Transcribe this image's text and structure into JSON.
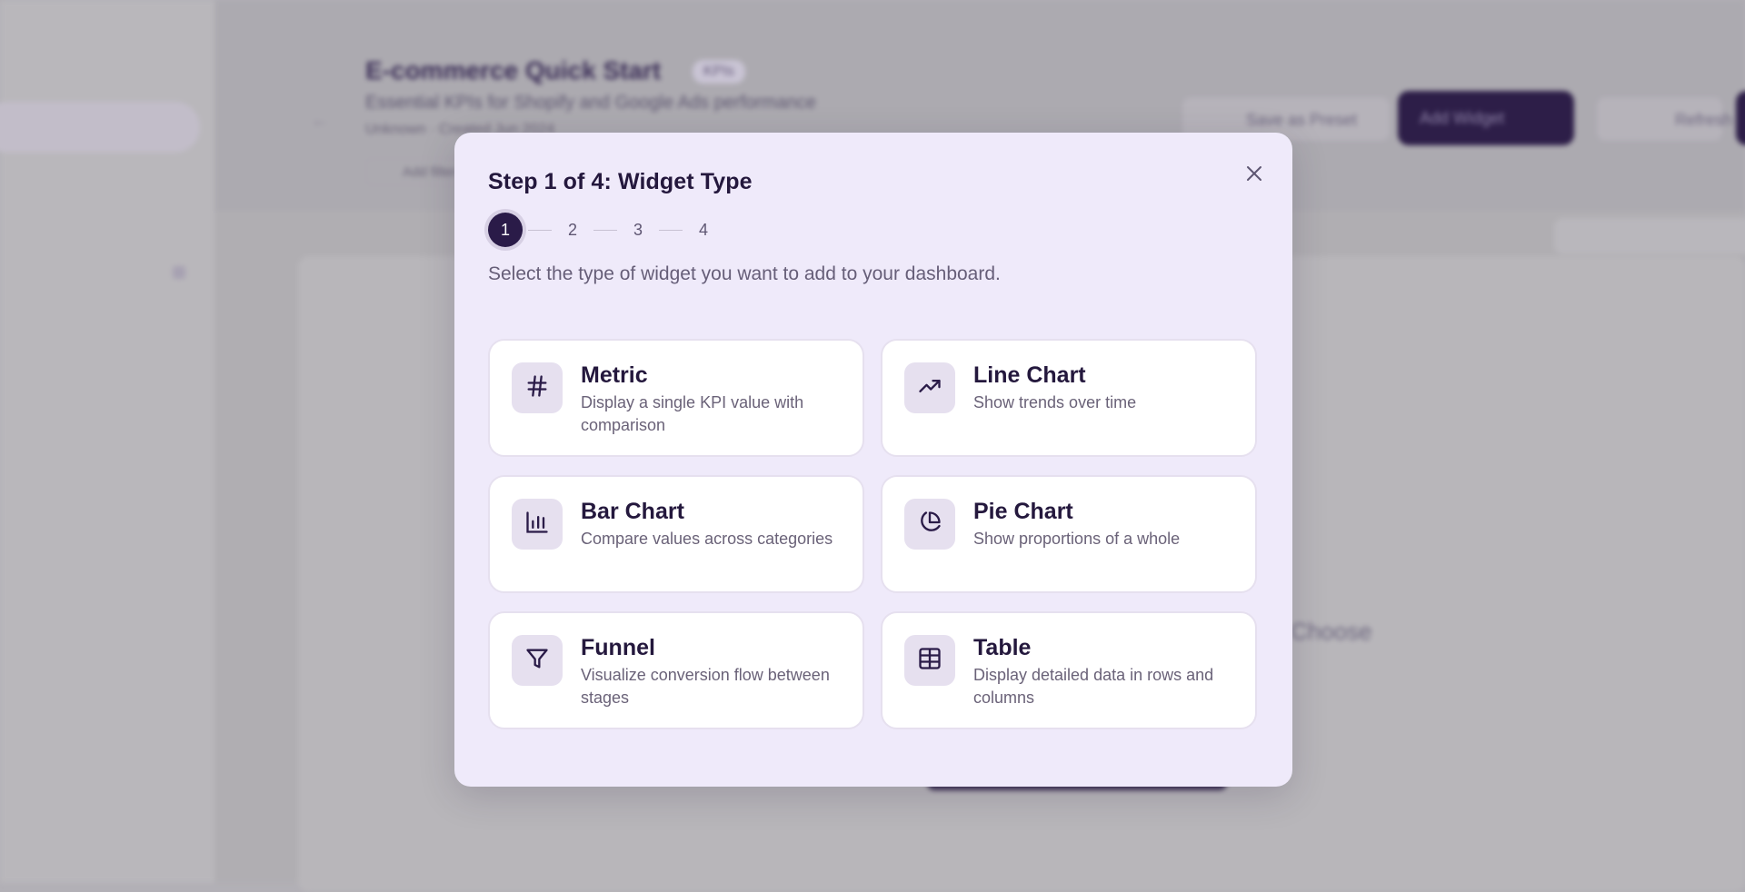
{
  "background": {
    "page_title": "E-commerce Quick Start",
    "badge": "KPIs",
    "subtitle": "Essential KPIs for Shopify and Google Ads performance",
    "meta": "Unknown · Created Jun 2024",
    "filter_label": "Add filter",
    "save_preset_label": "Save as Preset",
    "add_widget_label": "Add Widget",
    "refresh_label": "Refresh",
    "empty_state_text": "Choose"
  },
  "modal": {
    "title": "Step 1 of 4: Widget Type",
    "steps": [
      "1",
      "2",
      "3",
      "4"
    ],
    "current_step": 1,
    "description": "Select the type of widget you want to add to your dashboard.",
    "widget_types": [
      {
        "name": "Metric",
        "description": "Display a single KPI value with comparison",
        "icon": "hash-icon"
      },
      {
        "name": "Line Chart",
        "description": "Show trends over time",
        "icon": "trending-up-icon"
      },
      {
        "name": "Bar Chart",
        "description": "Compare values across categories",
        "icon": "bar-chart-icon"
      },
      {
        "name": "Pie Chart",
        "description": "Show proportions of a whole",
        "icon": "pie-chart-icon"
      },
      {
        "name": "Funnel",
        "description": "Visualize conversion flow between stages",
        "icon": "funnel-icon"
      },
      {
        "name": "Table",
        "description": "Display detailed data in rows and columns",
        "icon": "table-icon"
      }
    ]
  },
  "colors": {
    "accent_dark": "#2a1b48",
    "modal_bg": "#efeafa",
    "icon_tile_bg": "#e6e0ef",
    "overlay": "#b2b0b6"
  }
}
